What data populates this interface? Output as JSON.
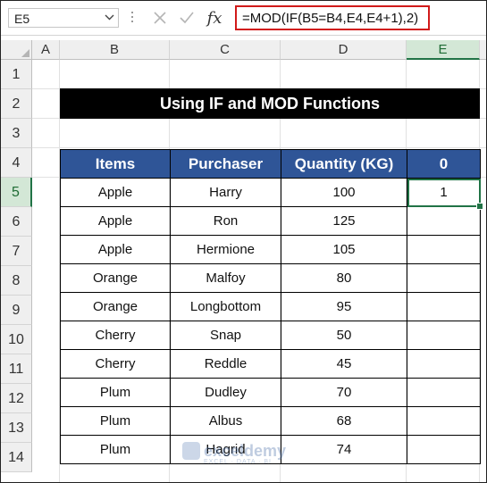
{
  "formula_bar": {
    "name_box": "E5",
    "formula": "=MOD(IF(B5=B4,E4,E4+1),2)",
    "fx_label": "fx"
  },
  "icons": {
    "name_box_dropdown": "chevron-down-icon",
    "cancel": "x-icon",
    "enter": "check-icon",
    "insert_function": "fx-icon"
  },
  "columns": [
    "A",
    "B",
    "C",
    "D",
    "E"
  ],
  "selected_column": "E",
  "rows": [
    "1",
    "2",
    "3",
    "4",
    "5",
    "6",
    "7",
    "8",
    "9",
    "10",
    "11",
    "12",
    "13",
    "14"
  ],
  "selected_row": "5",
  "title": "Using  IF and MOD Functions",
  "table": {
    "headers": [
      "Items",
      "Purchaser",
      "Quantity (KG)",
      "0"
    ],
    "rows": [
      [
        "Apple",
        "Harry",
        "100",
        "1"
      ],
      [
        "Apple",
        "Ron",
        "125",
        ""
      ],
      [
        "Apple",
        "Hermione",
        "105",
        ""
      ],
      [
        "Orange",
        "Malfoy",
        "80",
        ""
      ],
      [
        "Orange",
        "Longbottom",
        "95",
        ""
      ],
      [
        "Cherry",
        "Snap",
        "50",
        ""
      ],
      [
        "Cherry",
        "Reddle",
        "45",
        ""
      ],
      [
        "Plum",
        "Dudley",
        "70",
        ""
      ],
      [
        "Plum",
        "Albus",
        "68",
        ""
      ],
      [
        "Plum",
        "Hagrid",
        "74",
        ""
      ]
    ]
  },
  "watermark": {
    "name": "exceldemy",
    "tagline": "EXCEL · DATA · BI"
  },
  "colors": {
    "header_fill": "#2f5597",
    "title_fill": "#000000",
    "selection": "#217346",
    "formula_highlight": "#d11a1a"
  }
}
